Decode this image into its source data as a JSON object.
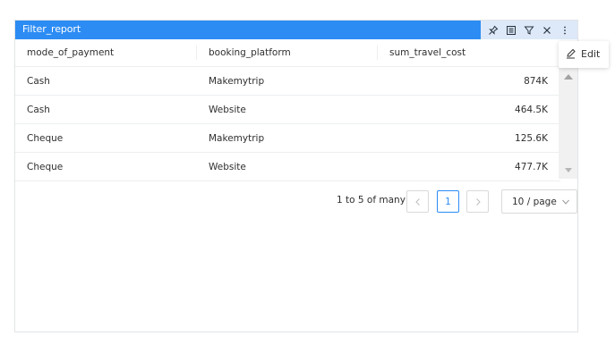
{
  "header": {
    "title": "Filter_report",
    "icons": [
      "pin-icon",
      "list-icon",
      "filter-icon",
      "close-icon",
      "more-icon"
    ]
  },
  "table": {
    "columns": [
      "mode_of_payment",
      "booking_platform",
      "sum_travel_cost"
    ],
    "rows": [
      {
        "mode_of_payment": "Cash",
        "booking_platform": "Makemytrip",
        "sum_travel_cost": "874K"
      },
      {
        "mode_of_payment": "Cash",
        "booking_platform": "Website",
        "sum_travel_cost": "464.5K"
      },
      {
        "mode_of_payment": "Cheque",
        "booking_platform": "Makemytrip",
        "sum_travel_cost": "125.6K"
      },
      {
        "mode_of_payment": "Cheque",
        "booking_platform": "Website",
        "sum_travel_cost": "477.7K"
      }
    ]
  },
  "pagination": {
    "range": "1 to 5 of many",
    "current_page": "1",
    "page_size": "10 / page"
  },
  "context_menu": {
    "edit_label": "Edit"
  },
  "colors": {
    "titlebar": "#2c8cf4",
    "toolbar": "#dde9f8",
    "active_page": "#2c8cf4"
  }
}
